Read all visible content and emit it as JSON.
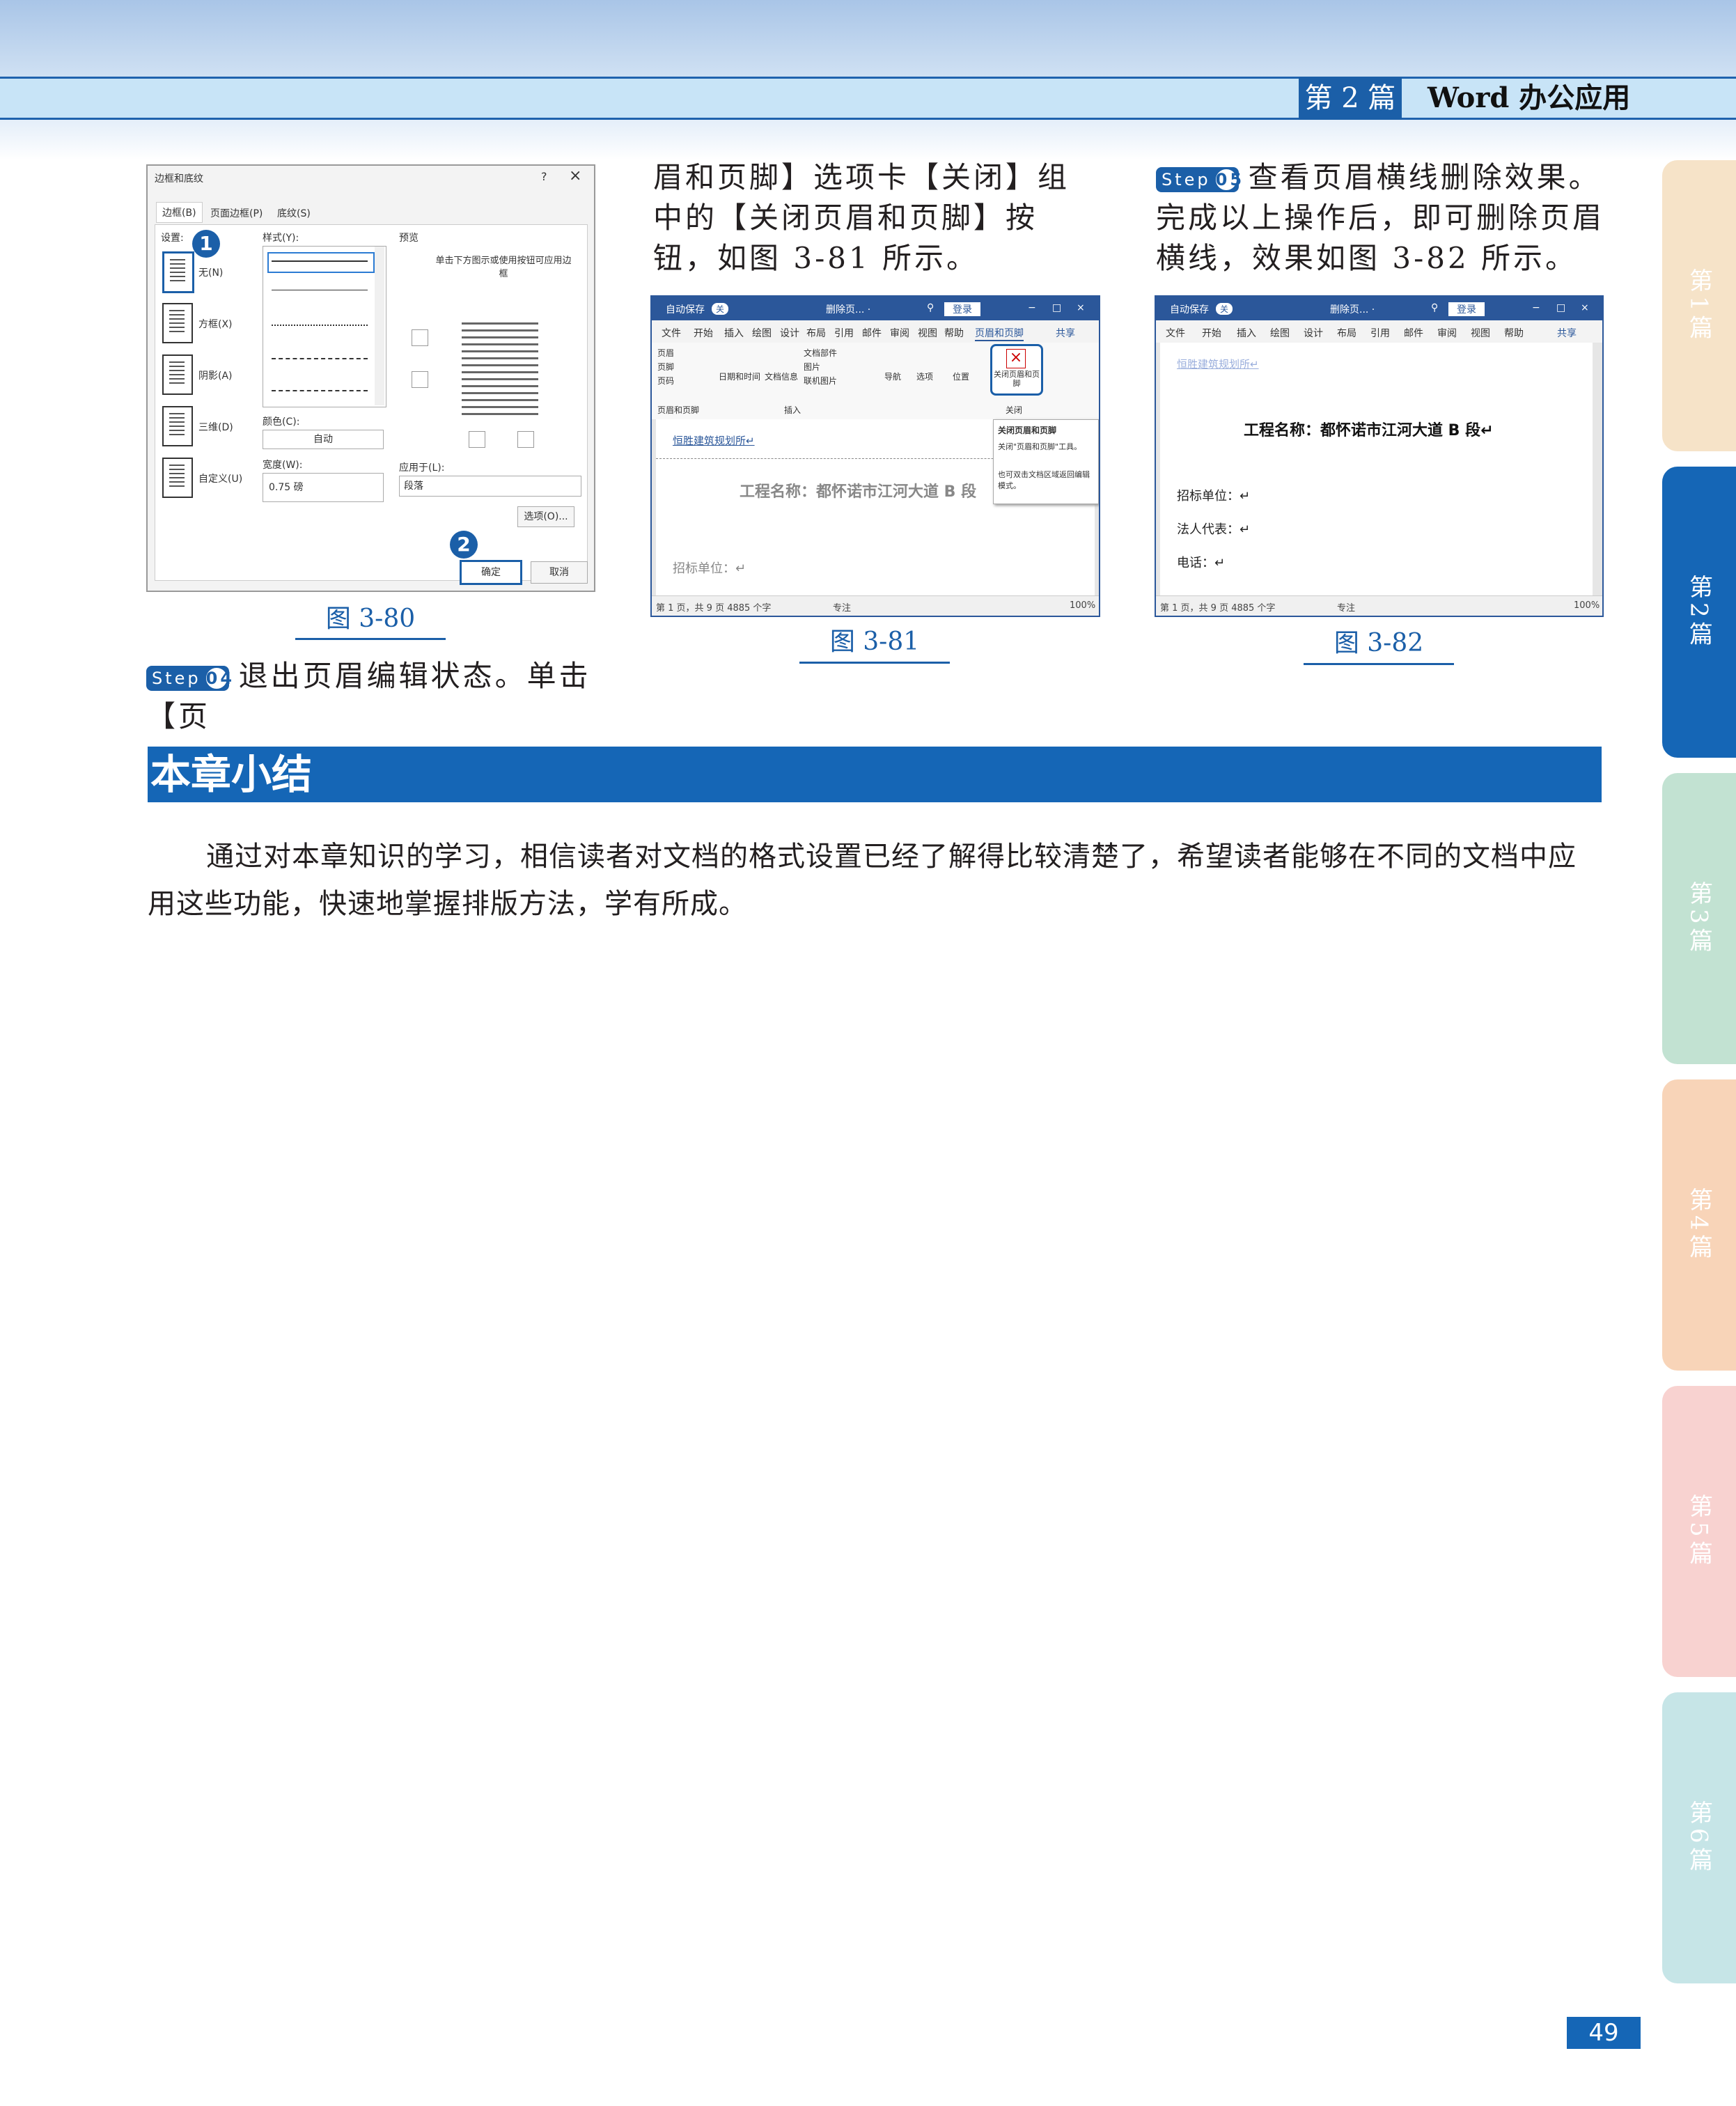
{
  "header": {
    "part": "第 2 篇",
    "title": "Word 办公应用"
  },
  "side_tabs": [
    {
      "label": "第1篇",
      "color": "#f6e3c8",
      "text_color": "#ffffff"
    },
    {
      "label": "第2篇",
      "color": "#1566b6",
      "text_color": "#ffffff"
    },
    {
      "label": "第3篇",
      "color": "#c2e2d2",
      "text_color": "#ffffff"
    },
    {
      "label": "第4篇",
      "color": "#f8d4b8",
      "text_color": "#ffffff"
    },
    {
      "label": "第5篇",
      "color": "#f8d2d0",
      "text_color": "#ffffff"
    },
    {
      "label": "第6篇",
      "color": "#c6e5e7",
      "text_color": "#ffffff"
    }
  ],
  "col2_text": "眉和页脚】选项卡【关闭】组中的【关闭页眉和页脚】按钮，如图 3-81 所示。",
  "step04": {
    "badge": "Step",
    "num": "04",
    "text": "退出页眉编辑状态。单击【页"
  },
  "step05": {
    "badge": "Step",
    "num": "05",
    "text": "查看页眉横线删除效果。完成以上操作后，即可删除页眉横线，效果如图 3-82 所示。"
  },
  "captions": {
    "fig80": "图 3-80",
    "fig81": "图 3-81",
    "fig82": "图 3-82"
  },
  "summary": {
    "title": "本章小结",
    "text": "通过对本章知识的学习，相信读者对文档的格式设置已经了解得比较清楚了，希望读者能够在不同的文档中应用这些功能，快速地掌握排版方法，学有所成。"
  },
  "page_number": "49",
  "fig80": {
    "title": "边框和底纹",
    "help": "?",
    "close": "×",
    "tabs": [
      "边框(B)",
      "页面边框(P)",
      "底纹(S)"
    ],
    "setting_label": "设置:",
    "settings": [
      "无(N)",
      "方框(X)",
      "阴影(A)",
      "三维(D)",
      "自定义(U)"
    ],
    "style_label": "样式(Y):",
    "color_label": "颜色(C):",
    "color_value": "自动",
    "width_label": "宽度(W):",
    "width_value": "0.75 磅",
    "preview_label": "预览",
    "preview_hint": "单击下方图示或使用按钮可应用边框",
    "apply_label": "应用于(L):",
    "apply_value": "段落",
    "options_button": "选项(O)...",
    "ok_button": "确定",
    "cancel_button": "取消",
    "marker1": "1",
    "marker2": "2"
  },
  "fig81": {
    "autosave": "自动保存",
    "autosave_state": "关",
    "doc_name": "删除页... ·",
    "login": "登录",
    "menu": [
      "文件",
      "开始",
      "插入",
      "绘图",
      "设计",
      "布局",
      "引用",
      "邮件",
      "审阅",
      "视图",
      "帮助",
      "页眉和页脚"
    ],
    "share": "共享",
    "ribbon": [
      "页眉",
      "页脚",
      "页码",
      "日期和时间",
      "文档信息",
      "文档部件",
      "图片",
      "联机图片",
      "导航",
      "选项",
      "位置",
      "关闭页眉和页脚"
    ],
    "groups": [
      "页眉和页脚",
      "插入",
      "关闭"
    ],
    "tooltip_title": "关闭页眉和页脚",
    "tooltip_line1": "关闭\"页眉和页脚\"工具。",
    "tooltip_line2": "也可双击文档区域返回编辑模式。",
    "header_text": "恒胜建筑规划所↵",
    "doc_title": "工程名称：都怀诺市江河大道 B 段",
    "doc_line": "招标单位：↵",
    "status": "第 1 页，共 9 页   4885 个字",
    "focus": "专注",
    "zoom": "100%"
  },
  "fig82": {
    "autosave": "自动保存",
    "autosave_state": "关",
    "doc_name": "删除页... ·",
    "login": "登录",
    "menu": [
      "文件",
      "开始",
      "插入",
      "绘图",
      "设计",
      "布局",
      "引用",
      "邮件",
      "审阅",
      "视图",
      "帮助"
    ],
    "share": "共享",
    "header_text": "恒胜建筑规划所↵",
    "doc_title": "工程名称：都怀诺市江河大道 B 段↵",
    "lines": [
      "招标单位：↵",
      "法人代表：↵",
      "电话：↵"
    ],
    "status": "第 1 页，共 9 页   4885 个字",
    "focus": "专注",
    "zoom": "100%"
  }
}
